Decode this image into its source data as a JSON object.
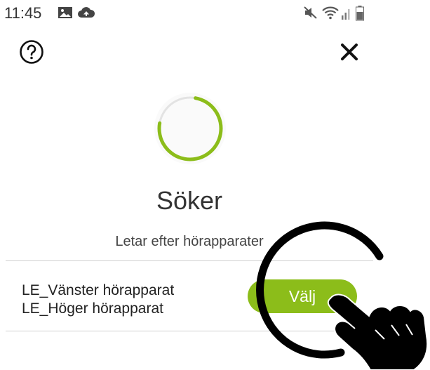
{
  "status_bar": {
    "time": "11:45",
    "icons": [
      "image-icon",
      "cloud-upload-icon",
      "mute-icon",
      "wifi-icon",
      "signal-icon",
      "battery-icon"
    ]
  },
  "header": {
    "help_icon": "help-circle-icon",
    "close_icon": "close-icon"
  },
  "search": {
    "title": "Söker",
    "subtitle": "Letar efter hörapparater"
  },
  "device_list": {
    "devices": [
      "LE_Vänster hörapparat",
      "LE_Höger hörapparat"
    ],
    "select_label": "Välj"
  },
  "colors": {
    "accent": "#8cbd1a",
    "spinner_track": "#e3e3e3",
    "divider": "#cfcfcf"
  }
}
